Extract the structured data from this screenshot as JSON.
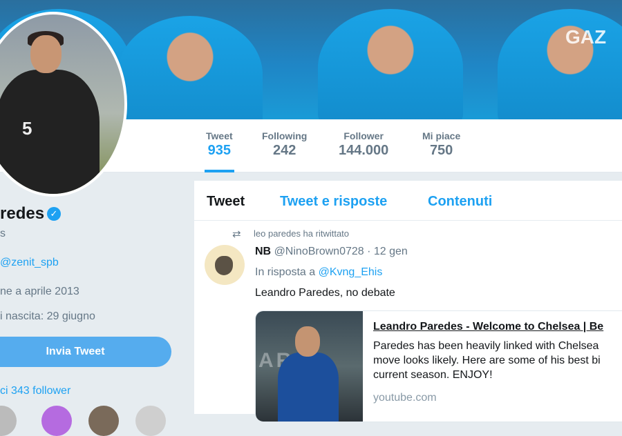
{
  "banner": {
    "sponsor_text": "GAZ"
  },
  "stats": [
    {
      "label": "Tweet",
      "value": "935"
    },
    {
      "label": "Following",
      "value": "242"
    },
    {
      "label": "Follower",
      "value": "144.000"
    },
    {
      "label": "Mi piace",
      "value": "750"
    }
  ],
  "profile": {
    "avatar_number": "5",
    "name": "redes",
    "handle_fragment": "s",
    "location_link": "@zenit_spb",
    "joined": "ne a aprile 2013",
    "birthday": "i nascita: 29 giugno",
    "send_tweet_label": "Invia Tweet",
    "followers_known": "ci 343 follower"
  },
  "timeline": {
    "tabs": [
      "Tweet",
      "Tweet e risposte",
      "Contenuti"
    ],
    "retweet_note": "leo paredes ha ritwittato",
    "tweet": {
      "author_initials": "NB",
      "author_handle": "@NinoBrown0728",
      "date": "· 12 gen",
      "reply_prefix": "In risposta a",
      "reply_to": "@Kvng_Ehis",
      "text": "Leandro Paredes, no debate",
      "card": {
        "image_text": "ARD",
        "title": "Leandro Paredes - Welcome to Chelsea | Be",
        "desc_lines": [
          "Paredes has been heavily linked with Chelsea",
          "move looks likely. Here are some of his best bi",
          "current season. ENJOY!"
        ],
        "domain": "youtube.com"
      }
    }
  },
  "colors": {
    "accent": "#1da1f2",
    "button": "#55acee",
    "muted": "#657786",
    "background": "#e6ecf0"
  }
}
